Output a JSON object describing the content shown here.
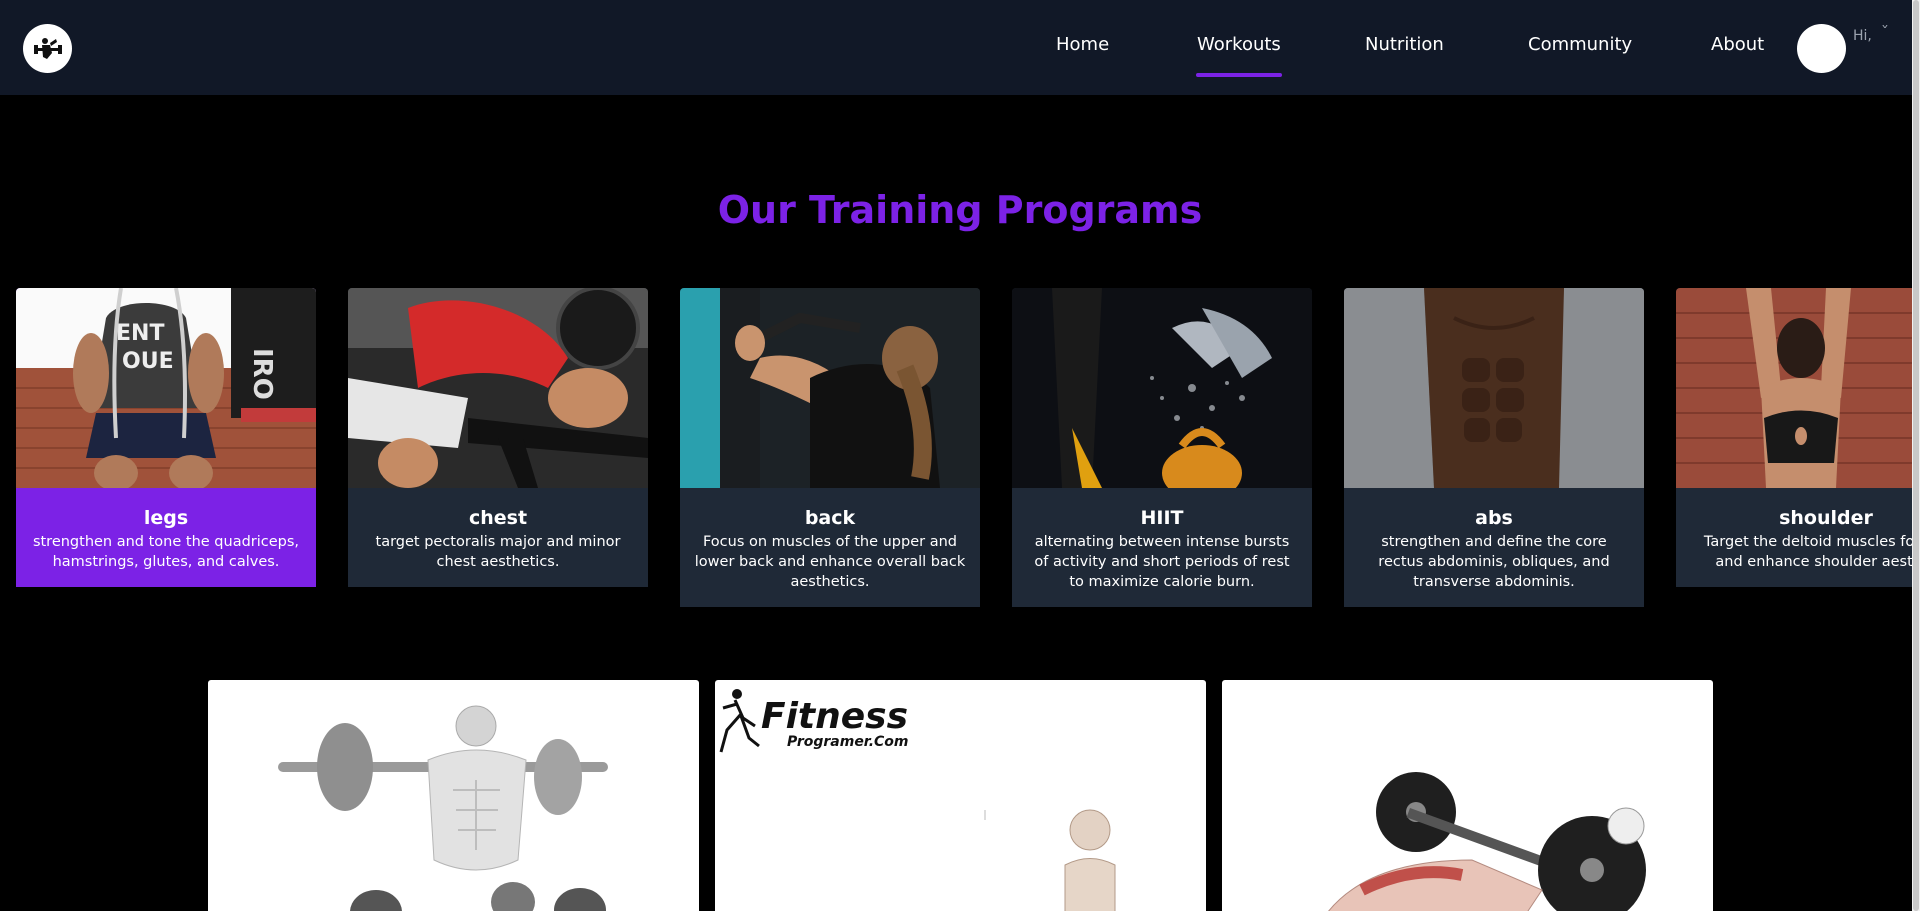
{
  "nav": {
    "items": [
      "Home",
      "Workouts",
      "Nutrition",
      "Community",
      "About"
    ],
    "active": "Workouts"
  },
  "user": {
    "greeting": "Hi,"
  },
  "section": {
    "title": "Our Training Programs"
  },
  "programs": [
    {
      "title": "legs",
      "desc": "strengthen and tone the quadriceps, hamstrings, glutes, and calves."
    },
    {
      "title": "chest",
      "desc": "target pectoralis major and minor chest aesthetics."
    },
    {
      "title": "back",
      "desc": "Focus on muscles of the upper and lower back and enhance overall back aesthetics."
    },
    {
      "title": "HIIT",
      "desc": "alternating between intense bursts of activity and short periods of rest to maximize calorie burn."
    },
    {
      "title": "abs",
      "desc": "strengthen and define the core rectus abdominis, obliques, and transverse abdominis."
    },
    {
      "title": "shoulder",
      "desc": "Target the deltoid muscles for def and enhance shoulder aesthet"
    }
  ],
  "exercise_brand": {
    "name": "Fitness",
    "sub": "Programer.Com"
  },
  "colors": {
    "accent": "#7c22e6",
    "header": "#111827",
    "card": "#1f2937"
  }
}
